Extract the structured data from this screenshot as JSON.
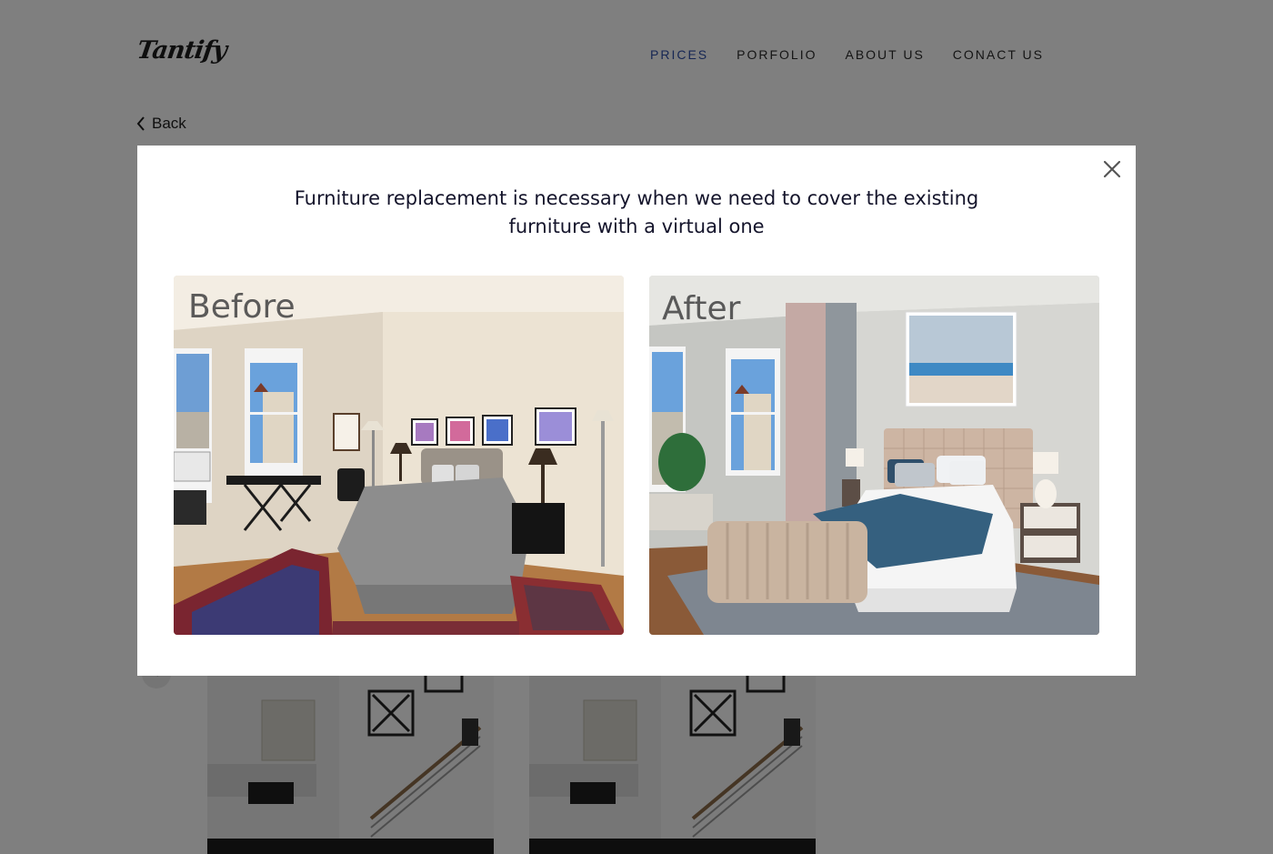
{
  "header": {
    "logo": "Tantify",
    "nav": [
      {
        "label": "PRICES",
        "active": true
      },
      {
        "label": "PORFOLIO",
        "active": false
      },
      {
        "label": "ABOUT US",
        "active": false
      },
      {
        "label": "CONACT US",
        "active": false
      }
    ]
  },
  "back": {
    "label": "Back",
    "icon": "chevron-left-icon"
  },
  "modal": {
    "title": "Furniture replacement is necessary when we need to cover the existing furniture with a virtual one",
    "close_icon": "close-icon",
    "images": [
      {
        "label": "Before",
        "scene": "bedroom with patterned rug, grey bedspread and piano"
      },
      {
        "label": "After",
        "scene": "virtually staged bedroom with tufted headboard and blue throw"
      }
    ]
  },
  "background_cards": {
    "prev_icon": "chevron-left-icon",
    "count": 2
  },
  "colors": {
    "accent": "#2e4fa9",
    "overlay": "rgba(0,0,0,0.5)",
    "text": "#14142b"
  }
}
